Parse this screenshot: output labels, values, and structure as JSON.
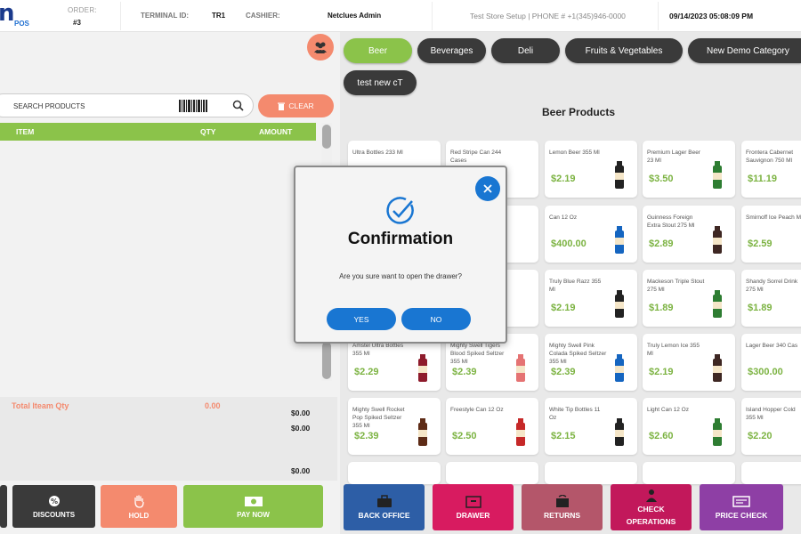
{
  "header": {
    "logo_text": "n",
    "logo_sub": "POS",
    "order_label": "ORDER:",
    "order_value": "#3",
    "terminal_label": "TERMINAL ID:",
    "terminal_value": "TR1",
    "cashier_label": "CASHIER:",
    "cashier_value": "Netclues Admin",
    "store_info": "Test Store Setup | PHONE # +1(345)946-0000",
    "datetime": "09/14/2023 05:08:09 PM"
  },
  "cart": {
    "search_placeholder": "SEARCH PRODUCTS",
    "clear_label": "CLEAR",
    "col_item": "ITEM",
    "col_qty": "QTY",
    "col_amount": "AMOUNT",
    "total_qty_label": "Total Iteam Qty",
    "total_qty_value": "0.00",
    "amount_1": "$0.00",
    "amount_2": "$0.00",
    "amount_3": "$0.00"
  },
  "actions": {
    "discounts": "DISCOUNTS",
    "hold": "HOLD",
    "pay_now": "PAY NOW"
  },
  "categories": [
    {
      "label": "Beer",
      "active": true
    },
    {
      "label": "Beverages",
      "active": false
    },
    {
      "label": "Deli",
      "active": false
    },
    {
      "label": "Fruits & Vegetables",
      "active": false
    },
    {
      "label": "New Demo Category",
      "active": false
    },
    {
      "label": "test new cT",
      "active": false
    }
  ],
  "products_title": "Beer Products",
  "products": [
    {
      "name": "Ultra Bottles 233 Ml",
      "price": ""
    },
    {
      "name": "Red Stripe Can 244 Cases",
      "price": ""
    },
    {
      "name": "Lemon Beer 355 Ml",
      "price": "$2.19"
    },
    {
      "name": "Premium Lager Beer 23 Ml",
      "price": "$3.50"
    },
    {
      "name": "Frontera Cabernet Sauvignon 750 Ml",
      "price": "$11.19"
    },
    {
      "name": "",
      "price": ""
    },
    {
      "name": "",
      "price": ""
    },
    {
      "name": "Can 12 Oz",
      "price": "$400.00"
    },
    {
      "name": "Guinness Foreign Extra Stout 275 Ml",
      "price": "$2.89"
    },
    {
      "name": "Smirnoff Ice Peach Ml",
      "price": "$2.59"
    },
    {
      "name": "",
      "price": ""
    },
    {
      "name": "355",
      "price": ""
    },
    {
      "name": "Truly Blue Razz 355 Ml",
      "price": "$2.19"
    },
    {
      "name": "Mackeson Triple Stout 275 Ml",
      "price": "$1.89"
    },
    {
      "name": "Shandy Sorrel Drink 275 Ml",
      "price": "$1.89"
    },
    {
      "name": "Amstel Ultra Bottles 355 Ml",
      "price": "$2.29"
    },
    {
      "name": "Mighty Swell Tigers Blood Spiked Seltzer 355 Ml",
      "price": "$2.39"
    },
    {
      "name": "Mighty Swell Pink Colada Spiked Seltzer 355 Ml",
      "price": "$2.39"
    },
    {
      "name": "Truly Lemon Ice 355 Ml",
      "price": "$2.19"
    },
    {
      "name": "Lager Beer 340 Cas",
      "price": "$300.00"
    },
    {
      "name": "Mighty Swell Rocket Pop Spiked Seltzer 355 Ml",
      "price": "$2.39"
    },
    {
      "name": "Freestyle Can 12 Oz",
      "price": "$2.50"
    },
    {
      "name": "White Tip Bottles 11 Oz",
      "price": "$2.15"
    },
    {
      "name": "Light Can 12 Oz",
      "price": "$2.60"
    },
    {
      "name": "Island Hopper Cold 355 Ml",
      "price": "$2.20"
    }
  ],
  "bottom_bar": {
    "back_office": "BACK OFFICE",
    "drawer": "DRAWER",
    "returns": "RETURNS",
    "check_operations_1": "CHECK",
    "check_operations_2": "OPERATIONS",
    "price_check": "PRICE CHECK"
  },
  "modal": {
    "title": "Confirmation",
    "message": "Are you sure want to open the drawer?",
    "yes": "YES",
    "no": "NO"
  },
  "colors": {
    "accent_green": "#8bc34a",
    "salmon": "#f48a6e",
    "blue": "#1976d2"
  }
}
